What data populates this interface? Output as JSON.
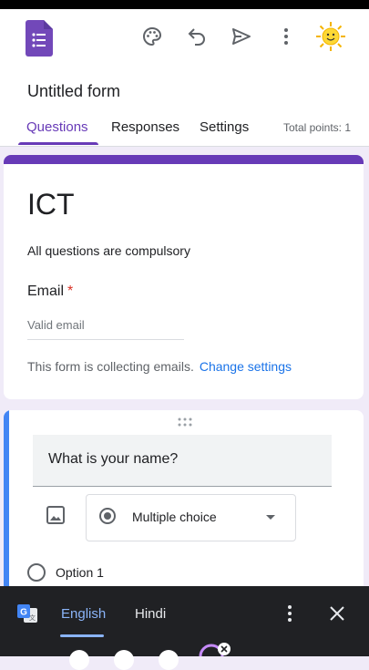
{
  "form": {
    "doc_title": "Untitled form",
    "tabs": [
      "Questions",
      "Responses",
      "Settings"
    ],
    "total_points": "Total points: 1",
    "title": "ICT",
    "description": "All questions are compulsory",
    "email_label": "Email",
    "required_mark": "*",
    "email_placeholder": "Valid email",
    "collecting_text": "This form is collecting emails.",
    "change_settings": "Change settings"
  },
  "question": {
    "title": "What is your name?",
    "type": "Multiple choice",
    "option1": "Option 1"
  },
  "translate": {
    "lang_active": "English",
    "lang_other": "Hindi"
  },
  "colors": {
    "accent": "#673ab7",
    "link": "#1a73e8",
    "question_bar": "#4285f4"
  }
}
